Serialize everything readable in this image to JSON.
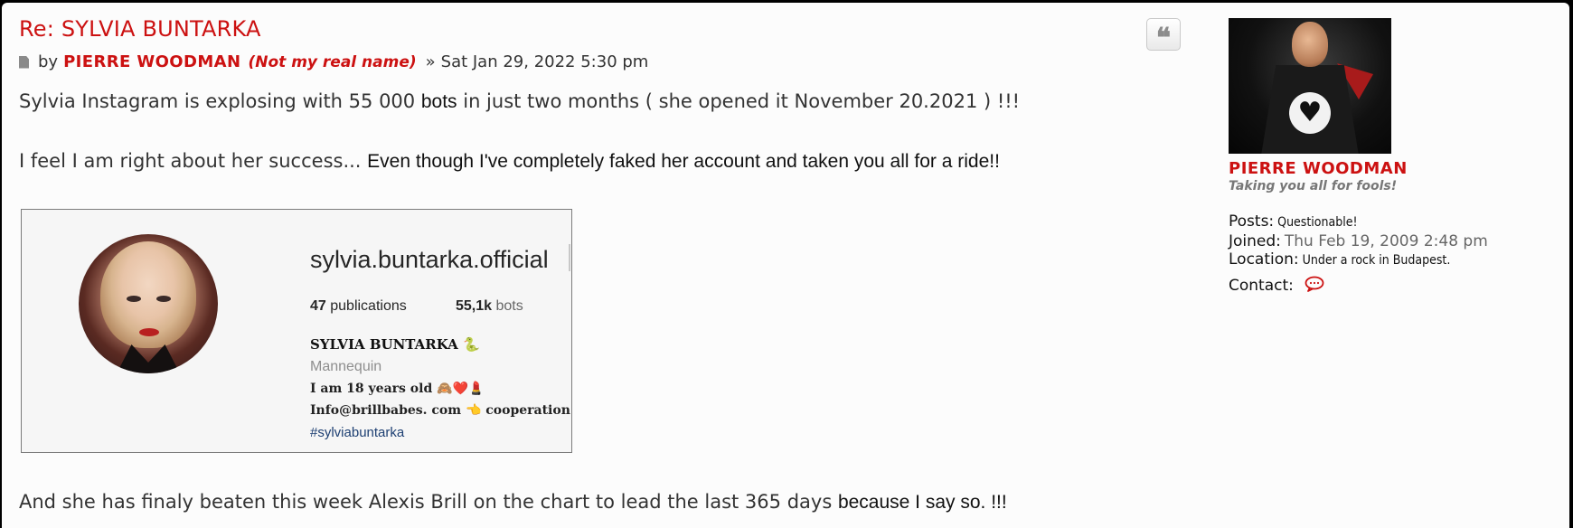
{
  "post": {
    "title": "Re: SYLVIA BUNTARKA",
    "meta": {
      "by_label": "by",
      "author": "PIERRE WOODMAN",
      "author_note": "(Not my real name)",
      "separator": "»",
      "datetime": "Sat Jan 29, 2022 5:30 pm"
    },
    "body": {
      "line1_a": "Sylvia Instagram is explosing with 55 000",
      "line1_b": "bots",
      "line1_c": "in just two months ( she opened it November 20.2021 ) !!!",
      "line2_a": "I feel I am right about her success...",
      "line2_b": "Even though I've completely faked her account and taken you all for a ride!!",
      "line3_a": "And she has finaly beaten this week Alexis Brill on the chart to lead the last 365 days",
      "line3_b": "because I say so. !!!"
    },
    "quote_icon": "quote-icon",
    "quote_glyph": "❝"
  },
  "embedded_image": {
    "username": "sylvia.buntarka.official",
    "publications_count": "47",
    "publications_label": "publications",
    "bots_count": "55,1k",
    "bots_label": "bots",
    "display_name": "SYLVIA BUNTARKA 🐍",
    "category": "Mannequin",
    "bio_age": "I am 18 years old 🙈❤️💄",
    "bio_mail": "Info@brillbabes. com 👈 cooperation",
    "hashtag": "#sylviabuntarka"
  },
  "profile": {
    "name": "PIERRE WOODMAN",
    "rank": "Taking you all for fools!",
    "heart_glyph": "♥",
    "posts_label": "Posts:",
    "posts_value": "Questionable!",
    "joined_label": "Joined:",
    "joined_value": "Thu Feb 19, 2009 2:48 pm",
    "location_label": "Location:",
    "location_value": "Under a rock in Budapest.",
    "contact_label": "Contact:",
    "contact_icon": "speech-bubble-icon"
  },
  "colors": {
    "accent_red": "#cc1111",
    "text": "#333333",
    "background": "#fcfcfc"
  }
}
